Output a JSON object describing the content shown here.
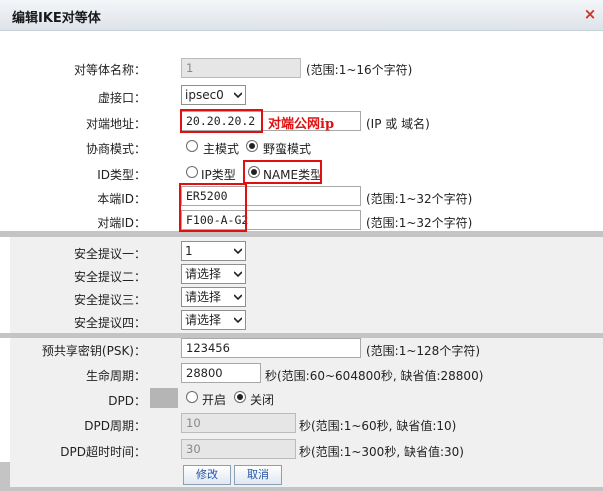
{
  "dialog": {
    "title": "编辑IKE对等体",
    "close_label": "×"
  },
  "fields": {
    "peer_name": {
      "label": "对等体名称：",
      "value": "1",
      "hint": "(范围:1~16个字符)"
    },
    "virtual_interface": {
      "label": "虚接口：",
      "value": "ipsec0"
    },
    "remote_address": {
      "label": "对端地址：",
      "value": "20.20.20.2",
      "annotation": "对端公网ip",
      "hint": "(IP 或 域名)"
    },
    "negotiation_mode": {
      "label": "协商模式：",
      "options": [
        "主模式",
        "野蛮模式"
      ],
      "selected": "野蛮模式"
    },
    "id_type": {
      "label": "ID类型：",
      "options": [
        "IP类型",
        "NAME类型"
      ],
      "selected": "NAME类型"
    },
    "local_id": {
      "label": "本端ID：",
      "value": "ER5200",
      "hint": "(范围:1~32个字符)"
    },
    "remote_id": {
      "label": "对端ID：",
      "value": "F100-A-G2",
      "hint": "(范围:1~32个字符)"
    }
  },
  "proposals": [
    {
      "label": "安全提议一：",
      "value": "1"
    },
    {
      "label": "安全提议二：",
      "value": "请选择"
    },
    {
      "label": "安全提议三：",
      "value": "请选择"
    },
    {
      "label": "安全提议四：",
      "value": "请选择"
    }
  ],
  "advanced": {
    "psk": {
      "label": "预共享密钥(PSK)：",
      "value": "123456",
      "hint": "(范围:1~128个字符)"
    },
    "lifetime": {
      "label": "生命周期：",
      "value": "28800",
      "hint": "秒(范围:60~604800秒, 缺省值:28800)"
    },
    "dpd": {
      "label": "DPD：",
      "options": [
        "开启",
        "关闭"
      ],
      "selected": "关闭"
    },
    "dpd_period": {
      "label": "DPD周期：",
      "value": "10",
      "hint": "秒(范围:1~60秒, 缺省值:10)"
    },
    "dpd_timeout": {
      "label": "DPD超时时间：",
      "value": "30",
      "hint": "秒(范围:1~300秒, 缺省值:30)"
    }
  },
  "buttons": {
    "modify": "修改",
    "cancel": "取消"
  },
  "colors": {
    "annotation_red": "#e01010",
    "section_gray": "#f0f0f0",
    "band_gray": "#c4c4c4"
  }
}
